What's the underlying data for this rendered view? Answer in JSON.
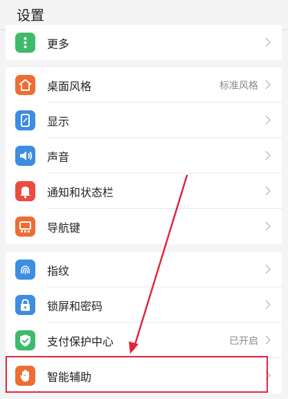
{
  "header": {
    "title": "设置"
  },
  "colors": {
    "green": "#3dbb6b",
    "orange": "#ee6d33",
    "blue": "#3d8de0",
    "red": "#ec4b3f",
    "highlight": "#e0243a"
  },
  "groups": [
    {
      "items": [
        {
          "label": "更多",
          "icon": "more-dots-icon",
          "value": ""
        }
      ]
    },
    {
      "items": [
        {
          "label": "桌面风格",
          "icon": "home-icon",
          "value": "标准风格"
        },
        {
          "label": "显示",
          "icon": "display-icon",
          "value": ""
        },
        {
          "label": "声音",
          "icon": "speaker-icon",
          "value": ""
        },
        {
          "label": "通知和状态栏",
          "icon": "bell-icon",
          "value": ""
        },
        {
          "label": "导航键",
          "icon": "navigation-keys-icon",
          "value": ""
        }
      ]
    },
    {
      "items": [
        {
          "label": "指纹",
          "icon": "fingerprint-icon",
          "value": ""
        },
        {
          "label": "锁屏和密码",
          "icon": "lock-icon",
          "value": ""
        },
        {
          "label": "支付保护中心",
          "icon": "shield-check-icon",
          "value": "已开启"
        },
        {
          "label": "智能辅助",
          "icon": "hand-icon",
          "value": ""
        }
      ]
    }
  ]
}
